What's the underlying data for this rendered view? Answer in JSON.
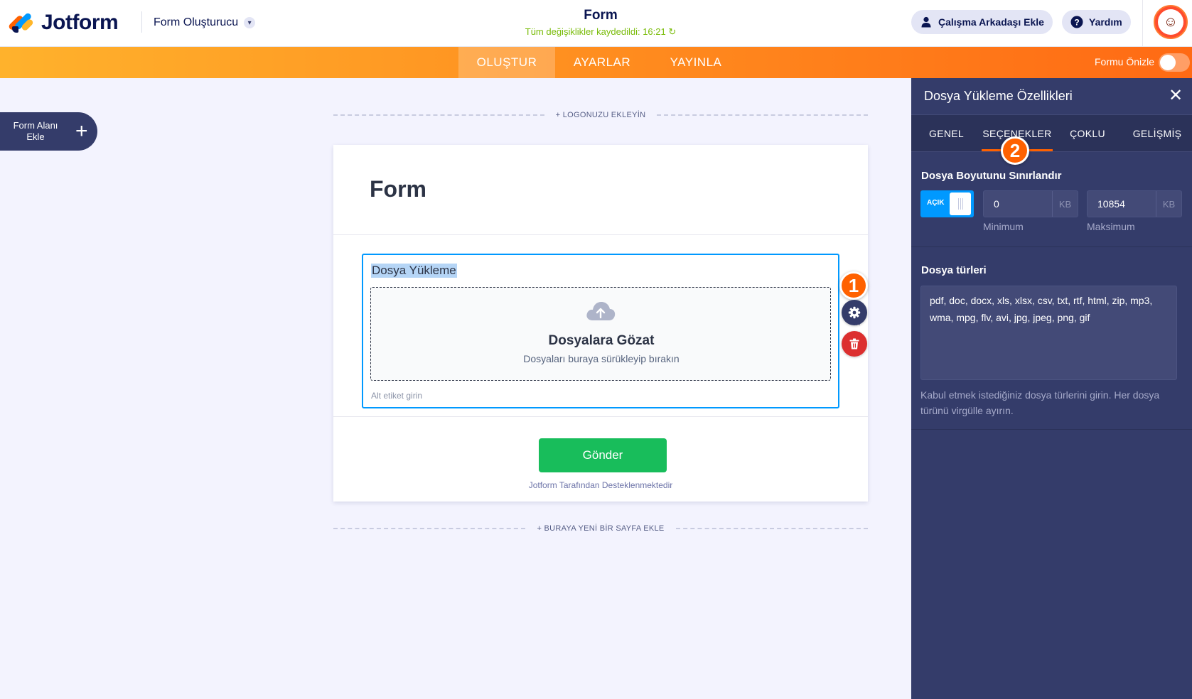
{
  "header": {
    "logo_text": "Jotform",
    "builder_label": "Form Oluşturucu",
    "form_name": "Form",
    "save_status": "Tüm değişiklikler kaydedildi: 16:21 ↻",
    "invite_label": "Çalışma Arkadaşı Ekle",
    "help_label": "Yardım"
  },
  "nav": {
    "tabs": [
      {
        "label": "OLUŞTUR",
        "active": true
      },
      {
        "label": "AYARLAR",
        "active": false
      },
      {
        "label": "YAYINLA",
        "active": false
      }
    ],
    "preview_label": "Formu Önizle",
    "preview_on": false
  },
  "sidebar": {
    "add_field_label": "Form Alanı Ekle"
  },
  "canvas": {
    "add_logo": "+ LOGONUZU EKLEYİN",
    "form_title": "Form",
    "upload_label": "Dosya Yükleme",
    "browse_title": "Dosyalara Gözat",
    "browse_sub": "Dosyaları buraya sürükleyip bırakın",
    "sublabel_placeholder": "Alt etiket girin",
    "submit_label": "Gönder",
    "powered_by": "Jotform Tarafından Desteklenmektedir",
    "add_page": "+ BURAYA YENİ BİR SAYFA EKLE"
  },
  "callouts": {
    "first": "1",
    "second": "2"
  },
  "panel": {
    "title": "Dosya Yükleme Özellikleri",
    "tabs": [
      "GENEL",
      "SEÇENEKLER",
      "ÇOKLU",
      "GELİŞMİŞ"
    ],
    "active_tab": "SEÇENEKLER",
    "limit_title": "Dosya Boyutunu Sınırlandır",
    "limit_toggle_label": "AÇIK",
    "min_value": "0",
    "max_value": "10854",
    "unit": "KB",
    "min_caption": "Minimum",
    "max_caption": "Maksimum",
    "types_title": "Dosya türleri",
    "types_value": "pdf, doc, docx, xls, xlsx, csv, txt, rtf, html, zip, mp3, wma, mpg, flv, avi, jpg, jpeg, png, gif",
    "types_help": "Kabul etmek istediğiniz dosya türlerini girin. Her dosya türünü virgülle ayırın."
  },
  "colors": {
    "accent_orange": "#ff6100",
    "accent_blue": "#0099ff",
    "panel_bg": "#343c6a",
    "submit_green": "#18bd5b",
    "danger_red": "#dc2f2f"
  },
  "icons": [
    "logo-icon",
    "chevron-down-icon",
    "user-icon",
    "help-icon",
    "avatar-icon",
    "plus-icon",
    "cloud-upload-icon",
    "gear-icon",
    "trash-icon",
    "close-icon",
    "drag-handle-icon"
  ]
}
